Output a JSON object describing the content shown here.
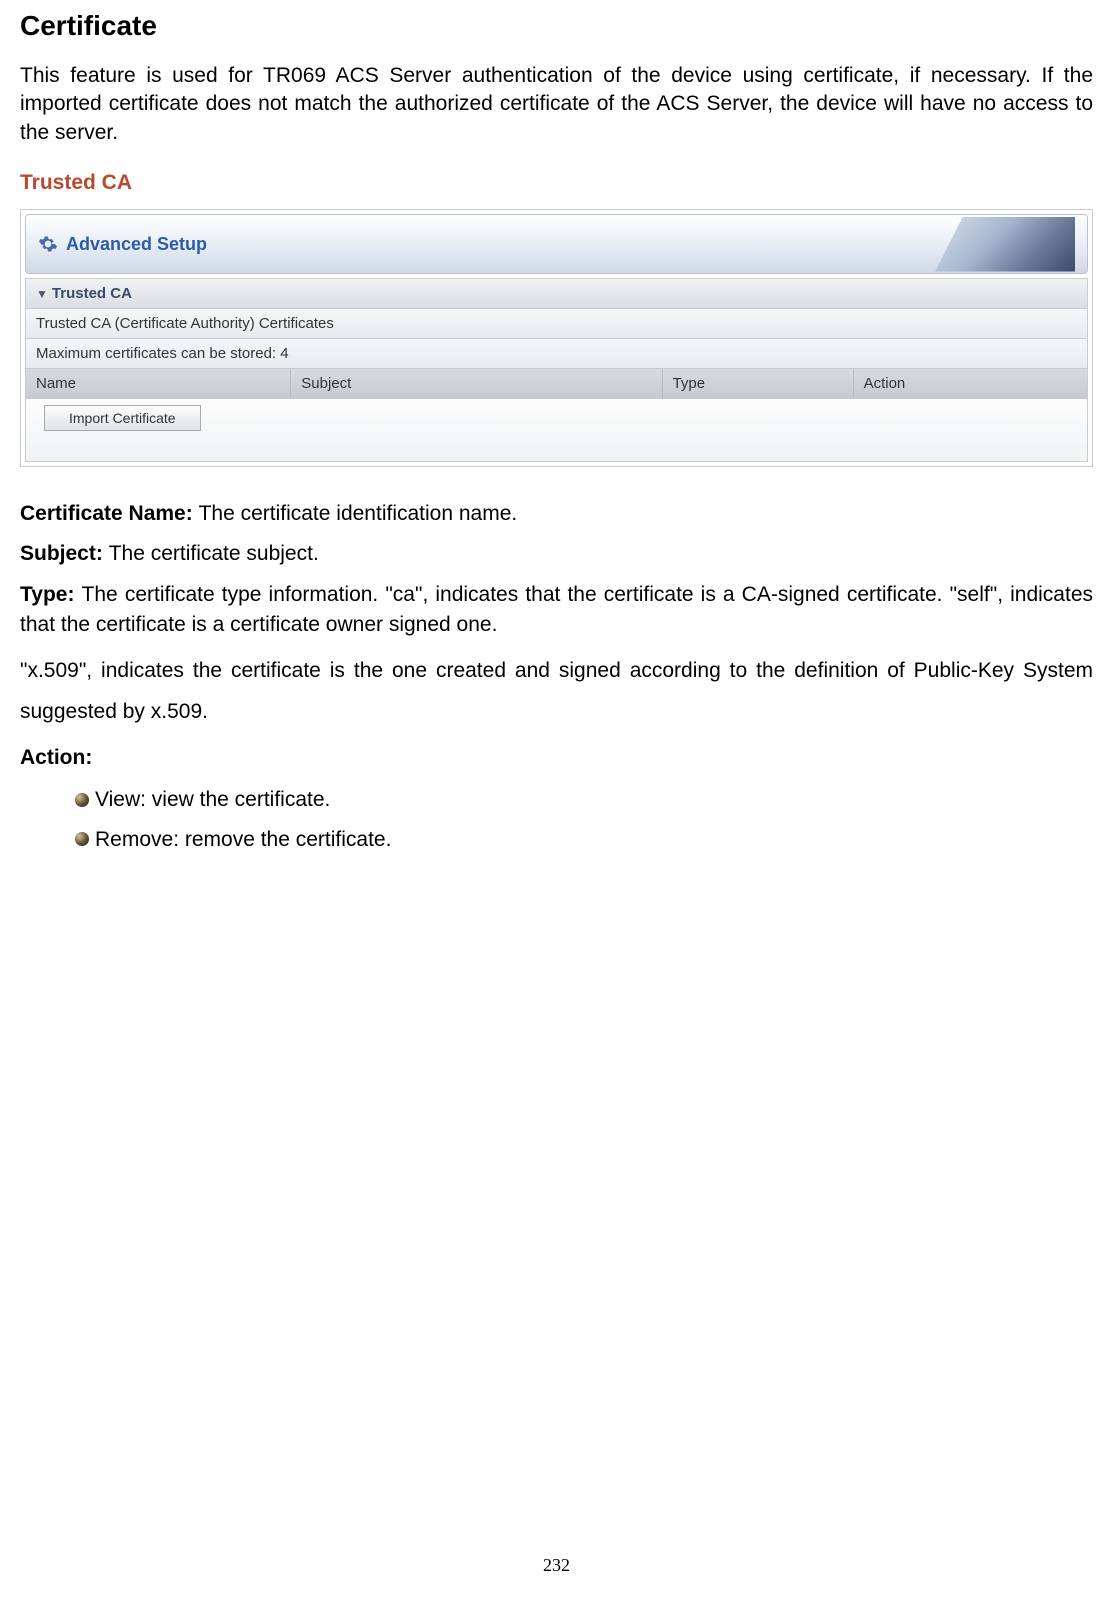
{
  "title": "Certificate",
  "intro": "This feature is used for TR069 ACS Server authentication of the device using certificate, if necessary. If the imported certificate does not match the authorized certificate of the ACS Server, the device will have no access to the server.",
  "sectionHeading": "Trusted CA",
  "screenshot": {
    "headerTitle": "Advanced Setup",
    "sectionLabel": "Trusted CA",
    "infoRow1": "Trusted CA (Certificate Authority) Certificates",
    "infoRow2": "Maximum certificates can be stored: 4",
    "columns": {
      "name": "Name",
      "subject": "Subject",
      "type": "Type",
      "action": "Action"
    },
    "importButton": "Import Certificate"
  },
  "definitions": {
    "certName": {
      "label": "Certificate Name: ",
      "text": "The certificate identification name."
    },
    "subject": {
      "label": "Subject: ",
      "text": "The certificate subject."
    },
    "type": {
      "label": "Type: ",
      "text": "The certificate type information. \"ca\", indicates that the certificate is a CA-signed certificate. \"self\", indicates that the certificate is a certificate owner signed one."
    },
    "x509": "\"x.509\", indicates the certificate is the one created and signed according to the definition of Public-Key System suggested by x.509.",
    "action": {
      "label": "Action:"
    },
    "actionItems": [
      "View: view the certificate.",
      "Remove: remove the certificate."
    ]
  },
  "pageNumber": "232"
}
